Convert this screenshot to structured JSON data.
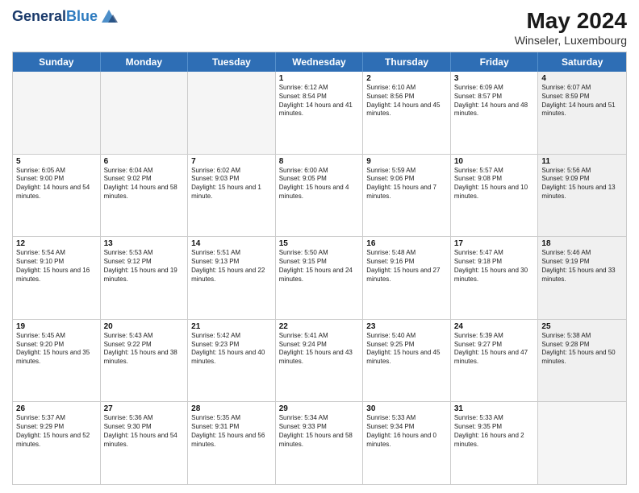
{
  "logo": {
    "line1": "General",
    "line2": "Blue"
  },
  "title": "May 2024",
  "location": "Winseler, Luxembourg",
  "days_header": [
    "Sunday",
    "Monday",
    "Tuesday",
    "Wednesday",
    "Thursday",
    "Friday",
    "Saturday"
  ],
  "weeks": [
    [
      {
        "day": "",
        "sunrise": "",
        "sunset": "",
        "daylight": "",
        "empty": true
      },
      {
        "day": "",
        "sunrise": "",
        "sunset": "",
        "daylight": "",
        "empty": true
      },
      {
        "day": "",
        "sunrise": "",
        "sunset": "",
        "daylight": "",
        "empty": true
      },
      {
        "day": "1",
        "sunrise": "Sunrise: 6:12 AM",
        "sunset": "Sunset: 8:54 PM",
        "daylight": "Daylight: 14 hours and 41 minutes.",
        "empty": false
      },
      {
        "day": "2",
        "sunrise": "Sunrise: 6:10 AM",
        "sunset": "Sunset: 8:56 PM",
        "daylight": "Daylight: 14 hours and 45 minutes.",
        "empty": false
      },
      {
        "day": "3",
        "sunrise": "Sunrise: 6:09 AM",
        "sunset": "Sunset: 8:57 PM",
        "daylight": "Daylight: 14 hours and 48 minutes.",
        "empty": false
      },
      {
        "day": "4",
        "sunrise": "Sunrise: 6:07 AM",
        "sunset": "Sunset: 8:59 PM",
        "daylight": "Daylight: 14 hours and 51 minutes.",
        "empty": false,
        "shaded": true
      }
    ],
    [
      {
        "day": "5",
        "sunrise": "Sunrise: 6:05 AM",
        "sunset": "Sunset: 9:00 PM",
        "daylight": "Daylight: 14 hours and 54 minutes.",
        "empty": false
      },
      {
        "day": "6",
        "sunrise": "Sunrise: 6:04 AM",
        "sunset": "Sunset: 9:02 PM",
        "daylight": "Daylight: 14 hours and 58 minutes.",
        "empty": false
      },
      {
        "day": "7",
        "sunrise": "Sunrise: 6:02 AM",
        "sunset": "Sunset: 9:03 PM",
        "daylight": "Daylight: 15 hours and 1 minute.",
        "empty": false
      },
      {
        "day": "8",
        "sunrise": "Sunrise: 6:00 AM",
        "sunset": "Sunset: 9:05 PM",
        "daylight": "Daylight: 15 hours and 4 minutes.",
        "empty": false
      },
      {
        "day": "9",
        "sunrise": "Sunrise: 5:59 AM",
        "sunset": "Sunset: 9:06 PM",
        "daylight": "Daylight: 15 hours and 7 minutes.",
        "empty": false
      },
      {
        "day": "10",
        "sunrise": "Sunrise: 5:57 AM",
        "sunset": "Sunset: 9:08 PM",
        "daylight": "Daylight: 15 hours and 10 minutes.",
        "empty": false
      },
      {
        "day": "11",
        "sunrise": "Sunrise: 5:56 AM",
        "sunset": "Sunset: 9:09 PM",
        "daylight": "Daylight: 15 hours and 13 minutes.",
        "empty": false,
        "shaded": true
      }
    ],
    [
      {
        "day": "12",
        "sunrise": "Sunrise: 5:54 AM",
        "sunset": "Sunset: 9:10 PM",
        "daylight": "Daylight: 15 hours and 16 minutes.",
        "empty": false
      },
      {
        "day": "13",
        "sunrise": "Sunrise: 5:53 AM",
        "sunset": "Sunset: 9:12 PM",
        "daylight": "Daylight: 15 hours and 19 minutes.",
        "empty": false
      },
      {
        "day": "14",
        "sunrise": "Sunrise: 5:51 AM",
        "sunset": "Sunset: 9:13 PM",
        "daylight": "Daylight: 15 hours and 22 minutes.",
        "empty": false
      },
      {
        "day": "15",
        "sunrise": "Sunrise: 5:50 AM",
        "sunset": "Sunset: 9:15 PM",
        "daylight": "Daylight: 15 hours and 24 minutes.",
        "empty": false
      },
      {
        "day": "16",
        "sunrise": "Sunrise: 5:48 AM",
        "sunset": "Sunset: 9:16 PM",
        "daylight": "Daylight: 15 hours and 27 minutes.",
        "empty": false
      },
      {
        "day": "17",
        "sunrise": "Sunrise: 5:47 AM",
        "sunset": "Sunset: 9:18 PM",
        "daylight": "Daylight: 15 hours and 30 minutes.",
        "empty": false
      },
      {
        "day": "18",
        "sunrise": "Sunrise: 5:46 AM",
        "sunset": "Sunset: 9:19 PM",
        "daylight": "Daylight: 15 hours and 33 minutes.",
        "empty": false,
        "shaded": true
      }
    ],
    [
      {
        "day": "19",
        "sunrise": "Sunrise: 5:45 AM",
        "sunset": "Sunset: 9:20 PM",
        "daylight": "Daylight: 15 hours and 35 minutes.",
        "empty": false
      },
      {
        "day": "20",
        "sunrise": "Sunrise: 5:43 AM",
        "sunset": "Sunset: 9:22 PM",
        "daylight": "Daylight: 15 hours and 38 minutes.",
        "empty": false
      },
      {
        "day": "21",
        "sunrise": "Sunrise: 5:42 AM",
        "sunset": "Sunset: 9:23 PM",
        "daylight": "Daylight: 15 hours and 40 minutes.",
        "empty": false
      },
      {
        "day": "22",
        "sunrise": "Sunrise: 5:41 AM",
        "sunset": "Sunset: 9:24 PM",
        "daylight": "Daylight: 15 hours and 43 minutes.",
        "empty": false
      },
      {
        "day": "23",
        "sunrise": "Sunrise: 5:40 AM",
        "sunset": "Sunset: 9:25 PM",
        "daylight": "Daylight: 15 hours and 45 minutes.",
        "empty": false
      },
      {
        "day": "24",
        "sunrise": "Sunrise: 5:39 AM",
        "sunset": "Sunset: 9:27 PM",
        "daylight": "Daylight: 15 hours and 47 minutes.",
        "empty": false
      },
      {
        "day": "25",
        "sunrise": "Sunrise: 5:38 AM",
        "sunset": "Sunset: 9:28 PM",
        "daylight": "Daylight: 15 hours and 50 minutes.",
        "empty": false,
        "shaded": true
      }
    ],
    [
      {
        "day": "26",
        "sunrise": "Sunrise: 5:37 AM",
        "sunset": "Sunset: 9:29 PM",
        "daylight": "Daylight: 15 hours and 52 minutes.",
        "empty": false
      },
      {
        "day": "27",
        "sunrise": "Sunrise: 5:36 AM",
        "sunset": "Sunset: 9:30 PM",
        "daylight": "Daylight: 15 hours and 54 minutes.",
        "empty": false
      },
      {
        "day": "28",
        "sunrise": "Sunrise: 5:35 AM",
        "sunset": "Sunset: 9:31 PM",
        "daylight": "Daylight: 15 hours and 56 minutes.",
        "empty": false
      },
      {
        "day": "29",
        "sunrise": "Sunrise: 5:34 AM",
        "sunset": "Sunset: 9:33 PM",
        "daylight": "Daylight: 15 hours and 58 minutes.",
        "empty": false
      },
      {
        "day": "30",
        "sunrise": "Sunrise: 5:33 AM",
        "sunset": "Sunset: 9:34 PM",
        "daylight": "Daylight: 16 hours and 0 minutes.",
        "empty": false
      },
      {
        "day": "31",
        "sunrise": "Sunrise: 5:33 AM",
        "sunset": "Sunset: 9:35 PM",
        "daylight": "Daylight: 16 hours and 2 minutes.",
        "empty": false
      },
      {
        "day": "",
        "sunrise": "",
        "sunset": "",
        "daylight": "",
        "empty": true,
        "shaded": true
      }
    ]
  ]
}
